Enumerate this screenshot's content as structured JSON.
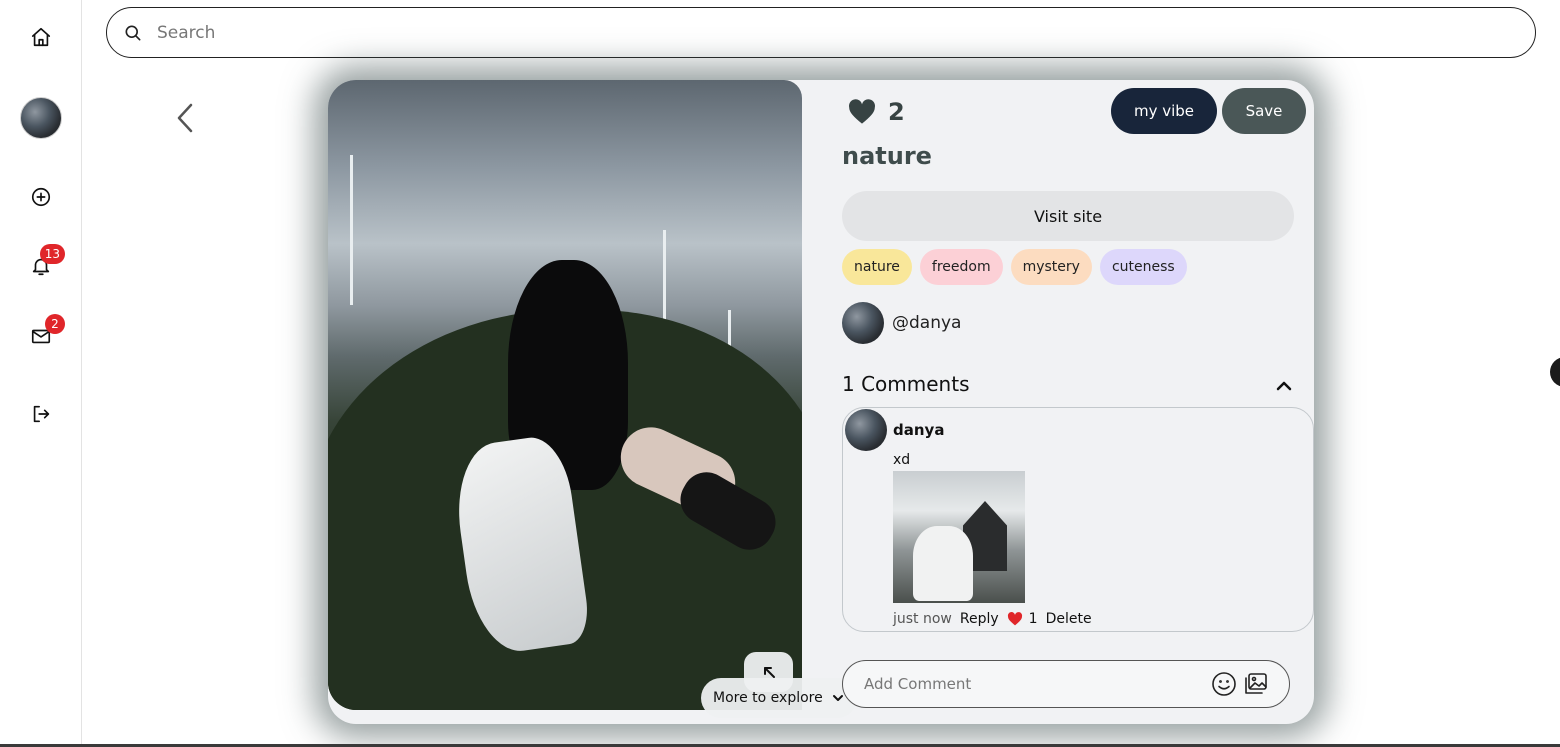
{
  "search": {
    "placeholder": "Search"
  },
  "sidebar": {
    "notifications_count": "13",
    "messages_count": "2"
  },
  "pin": {
    "likes": "2",
    "title": "nature",
    "my_vibe_label": "my vibe",
    "save_label": "Save",
    "visit_label": "Visit site",
    "tags": [
      {
        "label": "nature",
        "color": "#f9e79a"
      },
      {
        "label": "freedom",
        "color": "#fcd0d6"
      },
      {
        "label": "mystery",
        "color": "#fcdcc0"
      },
      {
        "label": "cuteness",
        "color": "#ddd7fb"
      }
    ],
    "author": "@danya"
  },
  "comments": {
    "header": "1 Comments",
    "items": [
      {
        "user": "danya",
        "text": "xd",
        "time": "just now",
        "reply_label": "Reply",
        "likes": "1",
        "delete_label": "Delete"
      }
    ]
  },
  "add_comment": {
    "placeholder": "Add Comment"
  },
  "more_to_explore": "More to explore",
  "colors": {
    "accent_dark": "#18253a",
    "save": "#4a5757",
    "badge": "#e0262a"
  }
}
